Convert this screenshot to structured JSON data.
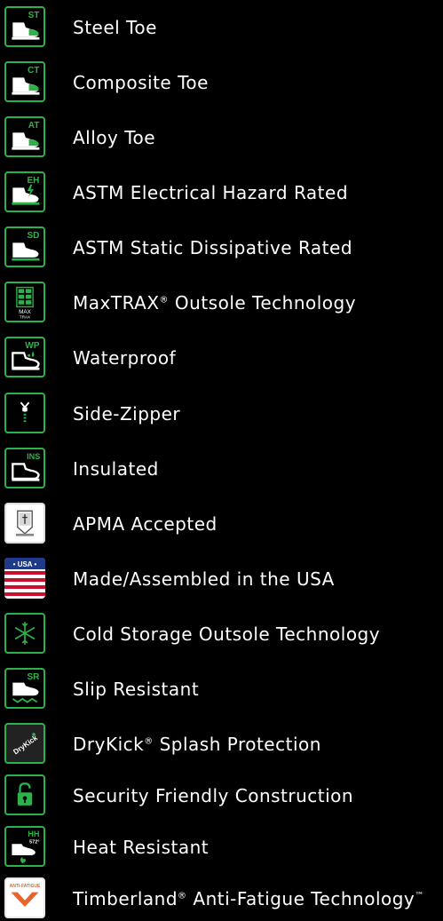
{
  "features": [
    {
      "code": "ST",
      "label": "Steel Toe"
    },
    {
      "code": "CT",
      "label": "Composite Toe"
    },
    {
      "code": "AT",
      "label": "Alloy Toe"
    },
    {
      "code": "EH",
      "label": "ASTM Electrical Hazard Rated"
    },
    {
      "code": "SD",
      "label": "ASTM Static Dissipative Rated"
    },
    {
      "code": "MAX TRAX",
      "label_main": "MaxTRAX",
      "label_sup": "®",
      "label_rest": " Outsole Technology"
    },
    {
      "code": "WP",
      "label": "Waterproof"
    },
    {
      "code": "",
      "label": "Side-Zipper"
    },
    {
      "code": "INS",
      "label": "Insulated"
    },
    {
      "code": "",
      "label": "APMA Accepted"
    },
    {
      "code": "• USA •",
      "label": "Made/Assembled in the USA"
    },
    {
      "code": "",
      "label": "Cold Storage Outsole Technology"
    },
    {
      "code": "SR",
      "label": "Slip Resistant"
    },
    {
      "code": "DryKick",
      "label_main": "DryKick",
      "label_sup": "®",
      "label_rest": " Splash Protection"
    },
    {
      "code": "",
      "label": "Security Friendly Construction"
    },
    {
      "code": "HH",
      "code_sub": "572°",
      "label": "Heat Resistant"
    },
    {
      "code": "ANTI-FATIGUE",
      "label_main": "Timberland",
      "label_sup": "®",
      "label_rest": " Anti-Fatigue Technology",
      "label_sup2": "™"
    }
  ],
  "colors": {
    "accent": "#2bb34a",
    "background": "#000000",
    "text": "#ffffff",
    "timberland_orange": "#e8642a"
  },
  "icons": [
    "steel-toe-icon",
    "composite-toe-icon",
    "alloy-toe-icon",
    "electrical-hazard-icon",
    "static-dissipative-icon",
    "maxtrax-icon",
    "waterproof-icon",
    "side-zipper-icon",
    "insulated-icon",
    "apma-seal-icon",
    "usa-flag-icon",
    "snowflake-icon",
    "slip-resistant-icon",
    "drykick-icon",
    "lock-icon",
    "heat-resistant-icon",
    "anti-fatigue-icon"
  ]
}
